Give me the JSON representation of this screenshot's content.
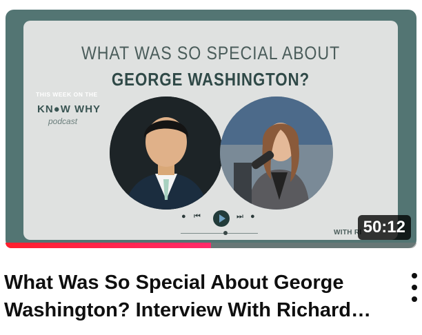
{
  "video": {
    "title": "What Was So Special About George Washington? Interview With Richard…",
    "duration": "50:12",
    "watch_progress_fraction": 0.5
  },
  "thumbnail": {
    "headline_line1": "WHAT WAS SO SPECIAL ABOUT",
    "headline_line2": "GEORGE WASHINGTON?",
    "brand_week": "THIS WEEK ON THE",
    "brand_name": "KN●W WHY",
    "brand_sub": "podcast",
    "with_tag": "WITH RI"
  },
  "icons": {
    "menu": "more-vert-icon",
    "prev": "skip-previous-icon",
    "play": "play-icon",
    "next": "skip-next-icon"
  },
  "colors": {
    "thumb_frame": "#537573",
    "thumb_panel": "#dfe1e0",
    "progress_red": "#ff1f2d"
  }
}
